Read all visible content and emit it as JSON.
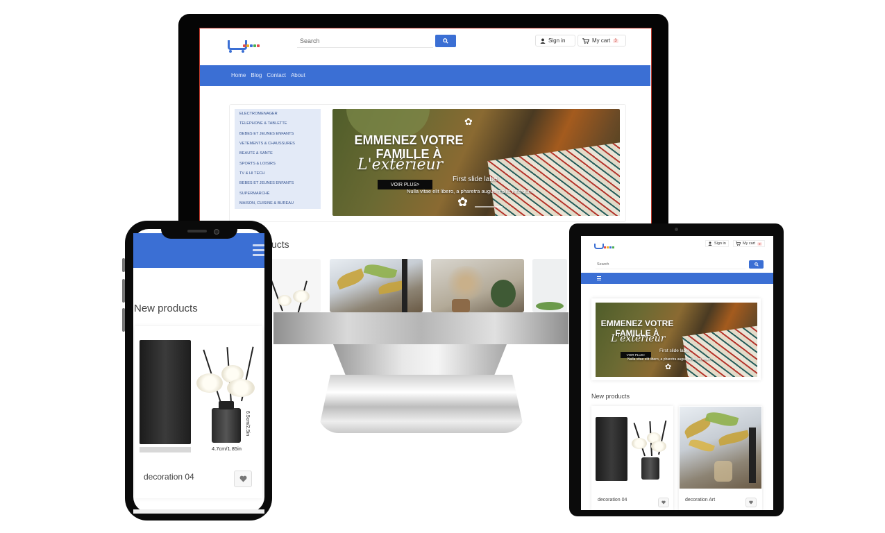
{
  "desktop": {
    "search_placeholder": "Search",
    "signin_label": "Sign in",
    "cart_label": "My cart",
    "cart_count": "3",
    "nav": [
      "Home",
      "Blog",
      "Contact",
      "About"
    ],
    "categories": [
      "ELECTROMENAGER",
      "TELEPHONE & TABLETTE",
      "BEBES ET JEUNES ENFANTS",
      "VETEMENTS & CHAUSSURES",
      "BEAUTE & SANTE",
      "SPORTS & LOISIRS",
      "TV & HI TECH",
      "BEBES ET JEUNES ENFANTS",
      "SUPERMARCHÉ",
      "MAISON, CUISINE & BUREAU"
    ],
    "banner": {
      "line1": "EMMENEZ VOTRE",
      "line2": "FAMILLE À",
      "script": "L'extérieur",
      "button": "VOIR PLUS>",
      "caption_label": "First slide label",
      "caption_text": "Nulla vitae elit libero, a pharetra augue mollis interdum."
    },
    "section_title_partial": "ucts"
  },
  "phone": {
    "section_title": "New products",
    "product_name": "decoration 04",
    "dimension_height": "6.5cm/2.5in",
    "dimension_width": "4.7cm/1.85in"
  },
  "tablet": {
    "signin_label": "Sign in",
    "cart_label": "My cart",
    "cart_count": "0",
    "search_placeholder": "Search",
    "banner": {
      "line1": "EMMENEZ VOTRE",
      "line2": "FAMILLE À",
      "script": "L'extérieur",
      "button": "VOIR PLUS>",
      "caption_label": "First slide label",
      "caption_text": "Nulla vitae elit libero, a pharetra augue mollis interdum."
    },
    "section_title": "New products",
    "products": [
      "decoration 04",
      "decoration Art"
    ]
  },
  "colors": {
    "primary": "#3b6fd4",
    "category_bg": "#e3eaf7",
    "device_frame": "#0a0a0a"
  },
  "icons": [
    "search-icon",
    "user-icon",
    "cart-icon",
    "hamburger-icon",
    "heart-icon"
  ]
}
